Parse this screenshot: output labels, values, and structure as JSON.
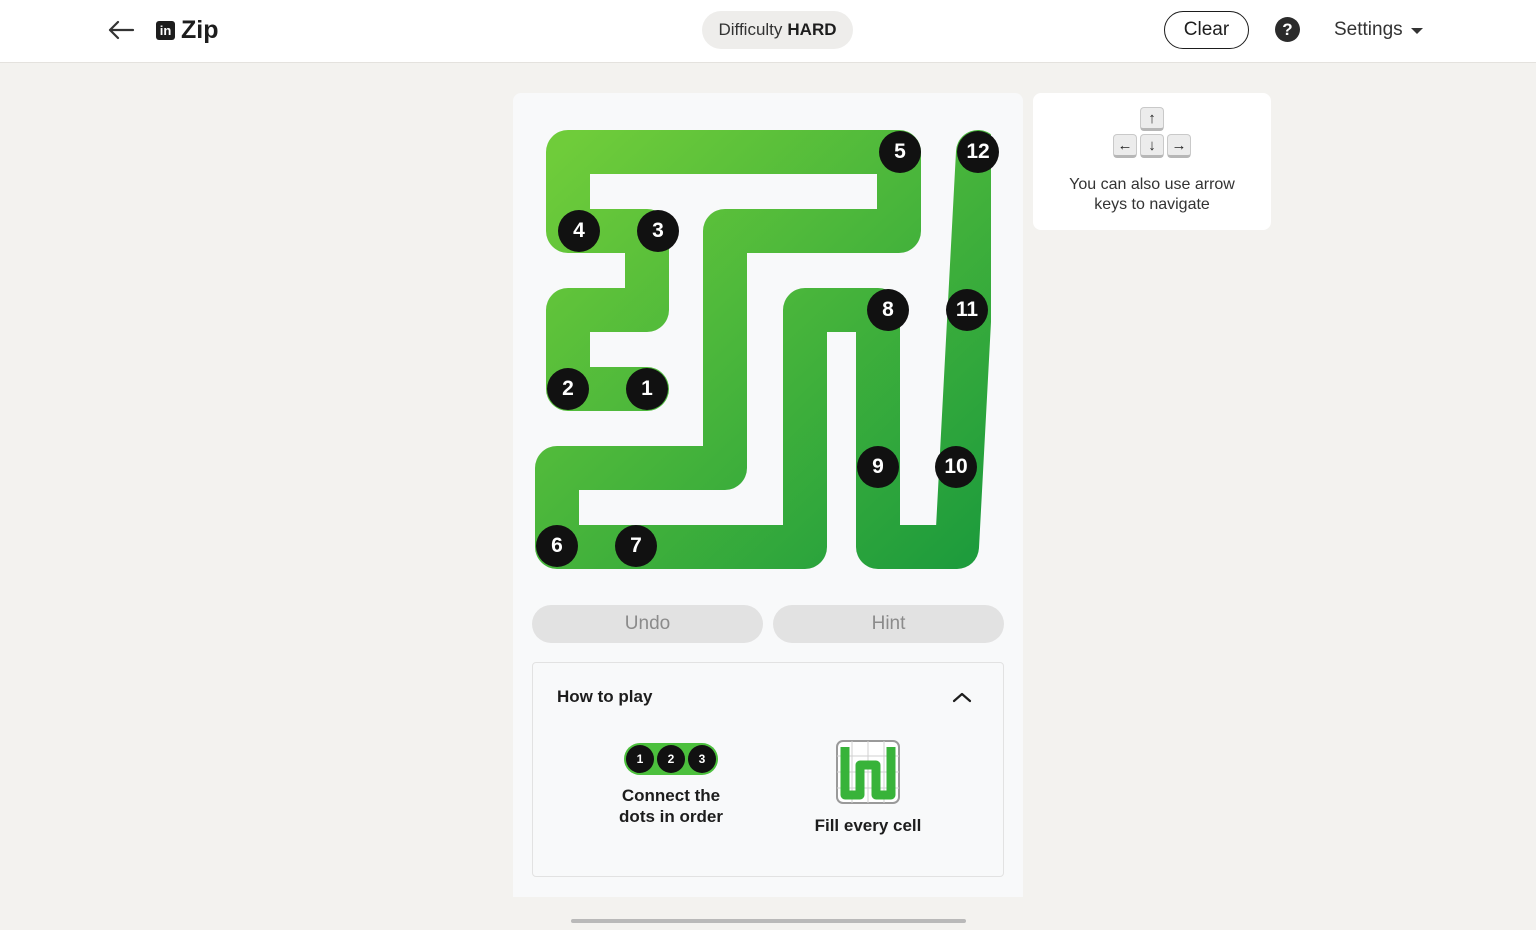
{
  "header": {
    "back_icon": "arrow-left-icon",
    "logo_text": "in",
    "title": "Zip",
    "difficulty_label": "Difficulty",
    "difficulty_value": "HARD",
    "clear_label": "Clear",
    "help_label": "?",
    "settings_label": "Settings"
  },
  "board": {
    "grid_size": 6,
    "path_color_start": "#6fcc3a",
    "path_color_end": "#1e9c3c",
    "dots": [
      {
        "n": "1",
        "row": 4,
        "col": 2
      },
      {
        "n": "2",
        "row": 4,
        "col": 1
      },
      {
        "n": "3",
        "row": 2,
        "col": 2
      },
      {
        "n": "4",
        "row": 2,
        "col": 1
      },
      {
        "n": "5",
        "row": 1,
        "col": 5
      },
      {
        "n": "6",
        "row": 6,
        "col": 1
      },
      {
        "n": "7",
        "row": 6,
        "col": 2
      },
      {
        "n": "8",
        "row": 3,
        "col": 5
      },
      {
        "n": "9",
        "row": 5,
        "col": 5
      },
      {
        "n": "10",
        "row": 5,
        "col": 6
      },
      {
        "n": "11",
        "row": 3,
        "col": 6
      },
      {
        "n": "12",
        "row": 1,
        "col": 6
      }
    ]
  },
  "controls": {
    "undo_label": "Undo",
    "hint_label": "Hint"
  },
  "how_to_play": {
    "heading": "How to play",
    "tip1_dots": [
      "1",
      "2",
      "3"
    ],
    "tip1_line1": "Connect the",
    "tip1_line2": "dots in order",
    "tip2_text": "Fill every cell"
  },
  "side_card": {
    "keys": {
      "up": "↑",
      "left": "←",
      "down": "↓",
      "right": "→"
    },
    "line1": "You can also use arrow",
    "line2": "keys to navigate"
  }
}
